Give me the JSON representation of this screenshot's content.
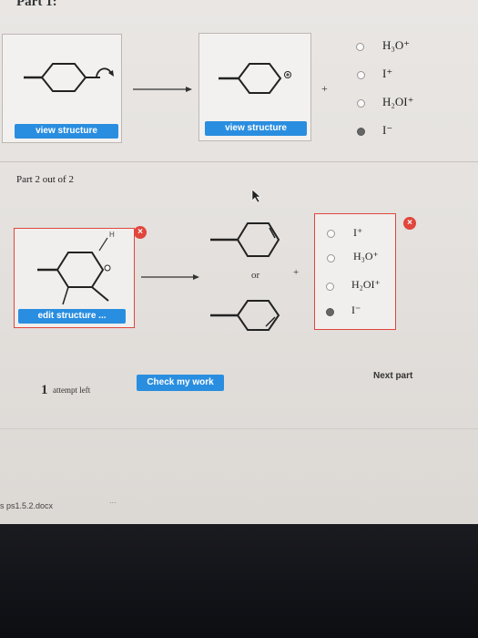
{
  "part1": {
    "title": "Part 1:",
    "view_structure_left": "view structure",
    "view_structure_right": "view structure",
    "plus": "+",
    "options": [
      {
        "label": "H₃O⁺",
        "selected": false
      },
      {
        "label": "I⁺",
        "selected": false
      },
      {
        "label": "H₂OI⁺",
        "selected": false
      },
      {
        "label": "I⁻",
        "selected": true
      }
    ]
  },
  "part2": {
    "title": "Part 2 out of 2",
    "h_label": "H",
    "edit_structure": "edit structure ...",
    "or": "or",
    "plus": "+",
    "x_mark": "×",
    "options": [
      {
        "label": "I⁺",
        "selected": false
      },
      {
        "label": "H₃O⁺",
        "selected": false
      },
      {
        "label": "H₂OI⁺",
        "selected": false
      },
      {
        "label": "I⁻",
        "selected": true
      }
    ]
  },
  "footer": {
    "attempts_number": "1",
    "attempts_label": "attempt left",
    "check_button": "Check my work",
    "next_part": "Next part"
  },
  "taskbar": {
    "file_name": "s ps1.5.2.docx",
    "more": "..."
  }
}
